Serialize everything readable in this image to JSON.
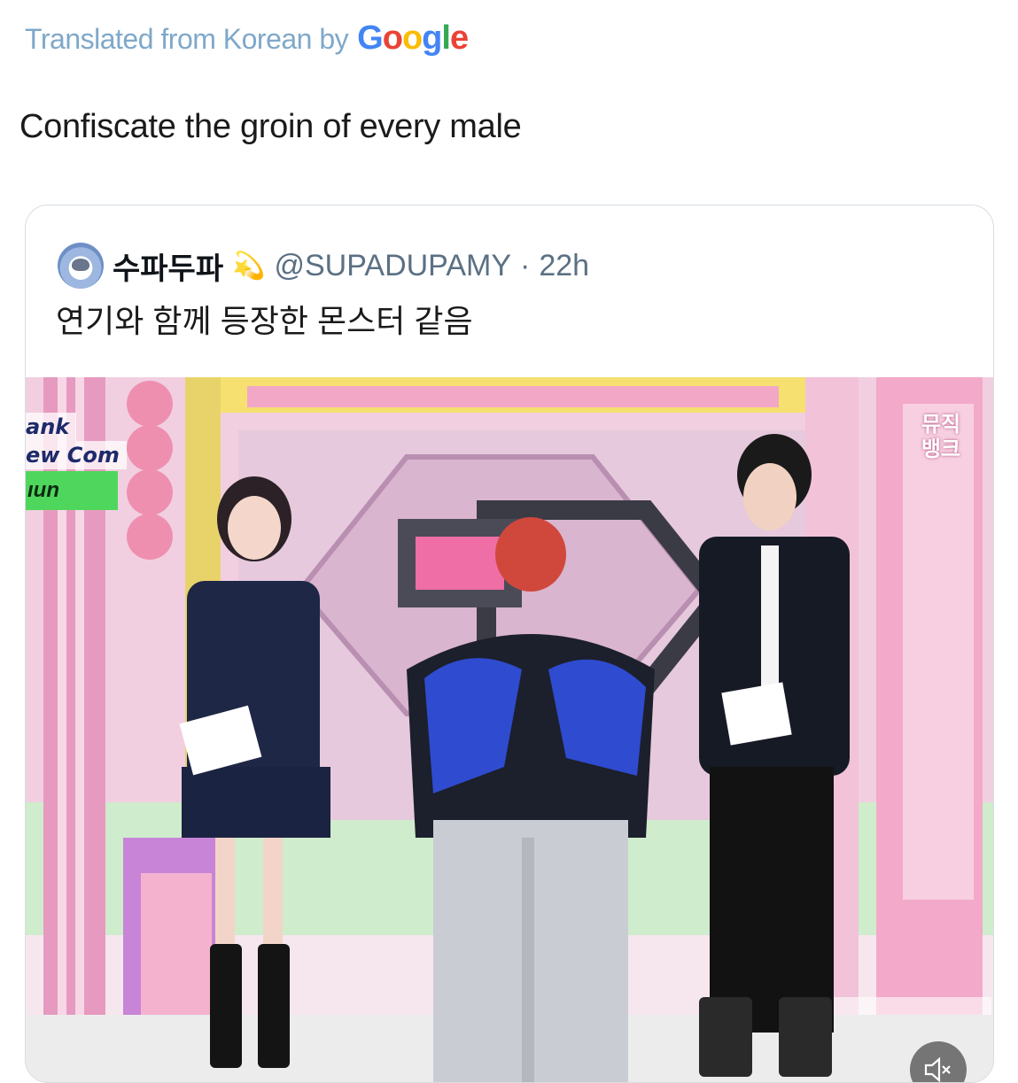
{
  "translation": {
    "prefix": "Translated from Korean by",
    "google_letters": [
      "G",
      "o",
      "o",
      "g",
      "l",
      "e"
    ]
  },
  "tweet": {
    "text": "Confiscate the groin of every male"
  },
  "quoted_tweet": {
    "display_name": "수파두파",
    "emoji": "💫",
    "handle": "@SUPADUPAMY",
    "separator": "·",
    "time": "22h",
    "text": "연기와 함께 등장한 몬스터 같음"
  },
  "video": {
    "overlay_lines": [
      "ank",
      "ew Com"
    ],
    "ticker": "ıun",
    "watermark_lines": [
      "뮤직",
      "뱅크"
    ],
    "mute_icon": "speaker-muted-icon"
  },
  "colors": {
    "translated": "#7fa8c9",
    "secondary_text": "#5b7083",
    "card_border": "#d6dde3"
  }
}
